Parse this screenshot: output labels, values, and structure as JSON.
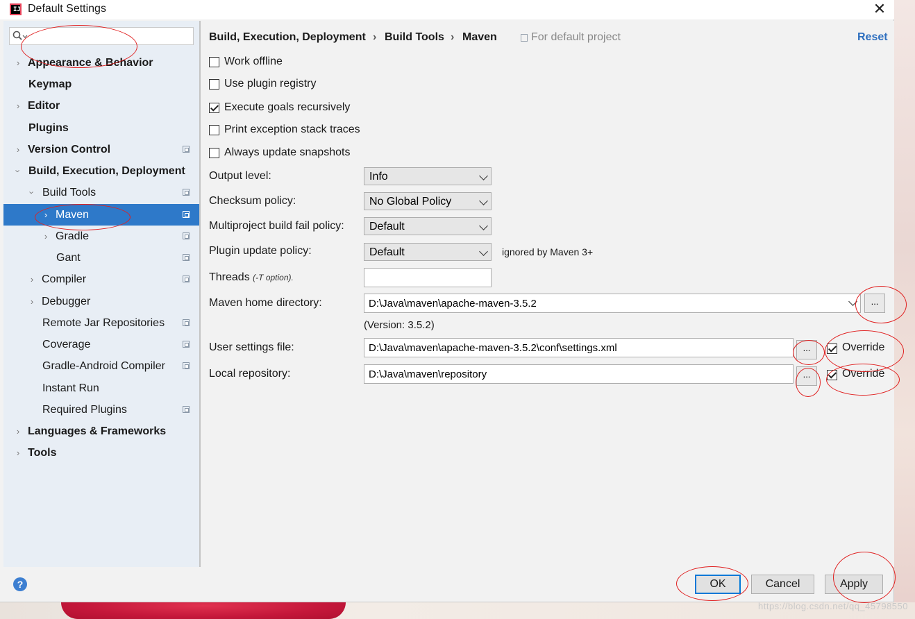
{
  "window": {
    "title": "Default Settings",
    "close_glyph": "✕"
  },
  "sidebar": {
    "search": {
      "placeholder": "",
      "value": ""
    },
    "items": [
      {
        "label": "Appearance & Behavior",
        "bold": true
      },
      {
        "label": "Keymap",
        "bold": true
      },
      {
        "label": "Editor",
        "bold": true
      },
      {
        "label": "Plugins",
        "bold": true
      },
      {
        "label": "Version Control",
        "bold": true
      },
      {
        "label": "Build, Execution, Deployment",
        "bold": true
      },
      {
        "label": "Build Tools"
      },
      {
        "label": "Maven",
        "selected": true
      },
      {
        "label": "Gradle"
      },
      {
        "label": "Gant"
      },
      {
        "label": "Compiler"
      },
      {
        "label": "Debugger"
      },
      {
        "label": "Remote Jar Repositories"
      },
      {
        "label": "Coverage"
      },
      {
        "label": "Gradle-Android Compiler"
      },
      {
        "label": "Instant Run"
      },
      {
        "label": "Required Plugins"
      },
      {
        "label": "Languages & Frameworks",
        "bold": true
      },
      {
        "label": "Tools",
        "bold": true
      }
    ]
  },
  "breadcrumb": {
    "part1": "Build, Execution, Deployment",
    "part2": "Build Tools",
    "part3": "Maven",
    "separator": "›",
    "scope": "For default project"
  },
  "reset_label": "Reset",
  "options": {
    "work_offline": {
      "label": "Work offline",
      "checked": false
    },
    "use_plugin_registry": {
      "label": "Use plugin registry",
      "checked": false
    },
    "execute_goals_recursively": {
      "label": "Execute goals recursively",
      "checked": true
    },
    "print_exception_stack_traces": {
      "label": "Print exception stack traces",
      "checked": false
    },
    "always_update_snapshots": {
      "label": "Always update snapshots",
      "checked": false
    }
  },
  "form": {
    "output_level": {
      "label": "Output level:",
      "value": "Info"
    },
    "checksum_policy": {
      "label": "Checksum policy:",
      "value": "No Global Policy"
    },
    "multiproject_fail_policy": {
      "label": "Multiproject build fail policy:",
      "value": "Default"
    },
    "plugin_update_policy": {
      "label": "Plugin update policy:",
      "value": "Default",
      "note": "ignored by Maven 3+"
    },
    "threads": {
      "label": "Threads",
      "hint": "(-T option).",
      "value": ""
    },
    "maven_home": {
      "label": "Maven home directory:",
      "value": "D:\\Java\\maven\\apache-maven-3.5.2",
      "version": "(Version: 3.5.2)"
    },
    "user_settings": {
      "label": "User settings file:",
      "value": "D:\\Java\\maven\\apache-maven-3.5.2\\conf\\settings.xml",
      "override_label": "Override",
      "override_checked": true
    },
    "local_repository": {
      "label": "Local repository:",
      "value": "D:\\Java\\maven\\repository",
      "override_label": "Override",
      "override_checked": true
    },
    "browse_label": "..."
  },
  "buttons": {
    "ok": "OK",
    "cancel": "Cancel",
    "apply": "Apply",
    "help": "?"
  },
  "watermark": "https://blog.csdn.net/qq_45798550",
  "colors": {
    "selection": "#2e79c9",
    "link": "#2e6fbf",
    "annotation": "#e02020"
  }
}
